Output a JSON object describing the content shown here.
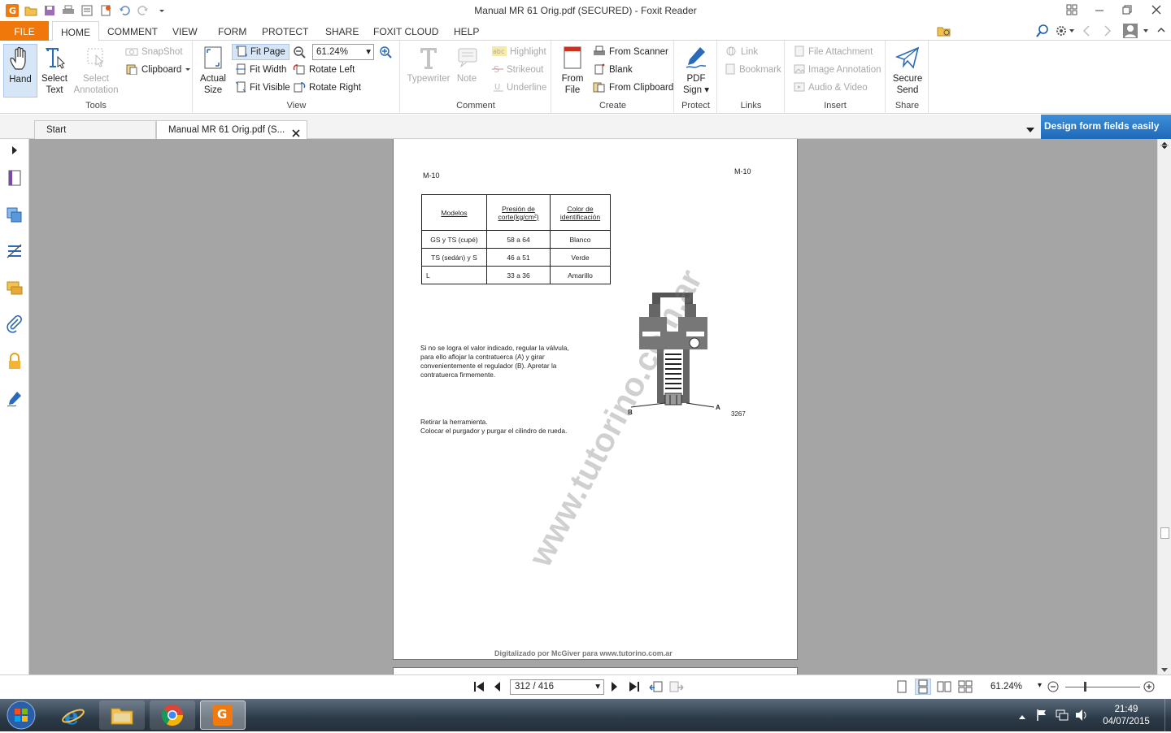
{
  "app": {
    "title": "Manual MR 61 Orig.pdf (SECURED) - Foxit Reader",
    "find_placeholder": "Find"
  },
  "ribbon_tabs": [
    "FILE",
    "HOME",
    "COMMENT",
    "VIEW",
    "FORM",
    "PROTECT",
    "SHARE",
    "FOXIT CLOUD",
    "HELP"
  ],
  "groups": {
    "tools": "Tools",
    "view": "View",
    "comment": "Comment",
    "create": "Create",
    "protect": "Protect",
    "links": "Links",
    "insert": "Insert",
    "share": "Share"
  },
  "buttons": {
    "hand": "Hand",
    "select_text_1": "Select",
    "select_text_2": "Text",
    "select_ann_1": "Select",
    "select_ann_2": "Annotation",
    "snapshot": "SnapShot",
    "clipboard": "Clipboard",
    "actual_1": "Actual",
    "actual_2": "Size",
    "fit_page": "Fit Page",
    "fit_width": "Fit Width",
    "fit_visible": "Fit Visible",
    "zoom": "61.24%",
    "rotate_left": "Rotate Left",
    "rotate_right": "Rotate Right",
    "typewriter": "Typewriter",
    "note": "Note",
    "highlight": "Highlight",
    "strikeout": "Strikeout",
    "underline": "Underline",
    "from_1": "From",
    "from_2": "File",
    "from_scanner": "From Scanner",
    "blank": "Blank",
    "from_clipboard": "From Clipboard",
    "pdf_sign_1": "PDF",
    "pdf_sign_2": "Sign",
    "link": "Link",
    "bookmark": "Bookmark",
    "file_attachment": "File Attachment",
    "image_annotation": "Image Annotation",
    "audio_video": "Audio & Video",
    "secure_1": "Secure",
    "secure_2": "Send"
  },
  "doc_tabs": {
    "start": "Start",
    "current": "Manual MR 61 Orig.pdf (S..."
  },
  "promo": "Design form fields easily",
  "pdf": {
    "header_left": "M-10",
    "header_right": "M-10",
    "table": {
      "headers": [
        "Modelos",
        "Presión de corte(kg/cm²)",
        "Color de identificación"
      ],
      "rows": [
        [
          "GS y TS (cupé)",
          "58 a 64",
          "Blanco"
        ],
        [
          "TS (sedán) y S",
          "46 a 51",
          "Verde"
        ],
        [
          "L",
          "33 a 36",
          "Amarillo"
        ]
      ]
    },
    "para1": "Si no se logra el valor indicado, regular la válvula, para ello aflojar la contratuerca (A) y girar convenientemente el regulador (B). Apretar la contratuerca firmemente.",
    "para2a": "Retirar la herramienta.",
    "para2b": "Colocar el purgador y purgar el cilindro de rueda.",
    "fig_label_a": "A",
    "fig_label_b": "B",
    "fig_number": "3267",
    "watermark": "www.tutorino.com.ar",
    "footer": "Digitalizado por McGiver para www.tutorino.com.ar"
  },
  "status": {
    "page": "312 / 416",
    "zoom": "61.24%"
  },
  "clock": {
    "time": "21:49",
    "date": "04/07/2015"
  }
}
